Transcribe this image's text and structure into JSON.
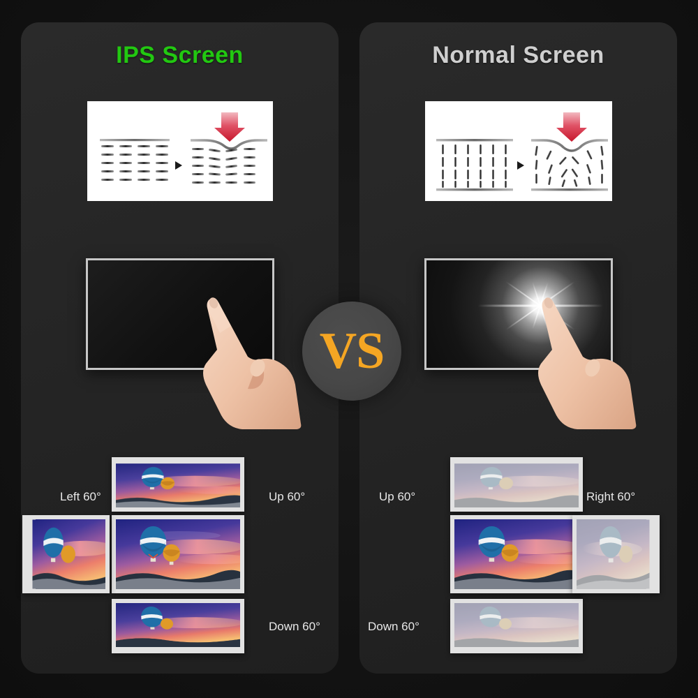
{
  "background_color": "#131313",
  "panel_color": "#262626",
  "panels": [
    {
      "id": "ips",
      "title": "IPS Screen",
      "title_color": "#22c811",
      "pressure_diagram": {
        "name": "ips-liquid-crystal-pressure-diagram",
        "left_state": "horizontal aligned crystal rows",
        "right_state": "crystal rows bend under finger pressure",
        "arrow_color": "#d81f33",
        "separator_icon": "play-triangle-icon"
      },
      "touch_demo": {
        "screen_state": "no glare, uniform dark screen",
        "hand_icon": "pointing-hand-icon"
      },
      "viewing_angles": {
        "left": "Left 60°",
        "up": "Up 60°",
        "down": "Down 60°",
        "image_quality": "full color, high contrast"
      }
    },
    {
      "id": "normal",
      "title": "Normal Screen",
      "title_color": "#cfcfcf",
      "pressure_diagram": {
        "name": "tn-liquid-crystal-pressure-diagram",
        "left_state": "vertical aligned crystal columns",
        "right_state": "crystal columns scatter under finger pressure",
        "arrow_color": "#d81f33",
        "separator_icon": "play-triangle-icon"
      },
      "touch_demo": {
        "screen_state": "bright white glare bloom at touch point",
        "hand_icon": "pointing-hand-icon"
      },
      "viewing_angles": {
        "up": "Up 60°",
        "right": "Right 60°",
        "down": "Down 60°",
        "image_quality": "washed out, low contrast"
      }
    }
  ],
  "vs_badge": {
    "label": "VS",
    "text_color": "#f5a623",
    "circle_color": "#474747"
  },
  "thumbnail_image": {
    "subject": "hot air balloons over mountains at sunset",
    "balloon_primary_color": "#1f6fa8",
    "balloon_secondary_color": "#e09a28",
    "sky_colors": [
      "#2b2f8c",
      "#7a4fa3",
      "#e8796a",
      "#f5b35e"
    ]
  }
}
